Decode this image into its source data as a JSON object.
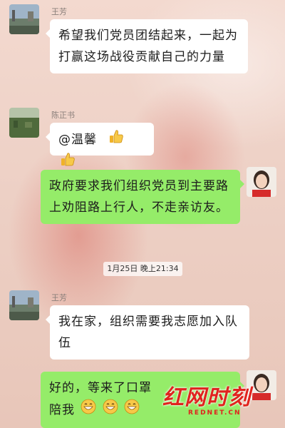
{
  "messages": [
    {
      "sender": "王芳",
      "text": "希望我们党员团结起来，一起为打赢这场战役贡献自己的力量"
    },
    {
      "sender": "陈正书",
      "text": "@温馨",
      "emoji": "thumbs-up-icon x2"
    },
    {
      "sender": "self",
      "text": "政府要求我们组织党员到主要路上劝阻路上行人，不走亲访友。"
    },
    {
      "time": "1月25日 晚上21:34"
    },
    {
      "sender": "王芳",
      "text": "我在家，组织需要我志愿加入队伍"
    },
    {
      "sender": "self",
      "text": "好的，等来了口罩",
      "line2": "陪我",
      "emoji": "grin-icon x3"
    }
  ],
  "watermark": {
    "text": "红网时刻",
    "sub": "REDNET.CN"
  },
  "colors": {
    "green_bubble": "#95ec69",
    "white_bubble": "#ffffff",
    "watermark": "#e0231e"
  }
}
